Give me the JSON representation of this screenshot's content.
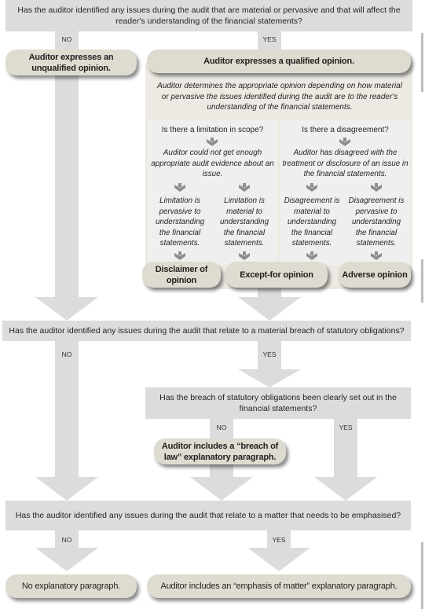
{
  "diagram": {
    "q1": {
      "text": "Has the auditor identified any issues during the audit that are material or pervasive and that will affect the reader's understanding of the financial statements?",
      "no_label": "NO",
      "yes_label": "YES"
    },
    "unqualified": "Auditor expresses an unqualified opinion.",
    "qualified": "Auditor expresses a qualified opinion.",
    "determines": "Auditor determines the appropriate opinion depending on how material or pervasive the issues identified during the audit are to the reader's understanding of the financial statements.",
    "scope": {
      "question": "Is there a limitation in scope?",
      "detail": "Auditor could not get enough appropriate audit evidence about an issue.",
      "pervasive": "Limitation is pervasive to understanding the financial statements.",
      "material": "Limitation is material to understanding the financial statements."
    },
    "disagreement": {
      "question": "Is there a disagreement?",
      "detail": "Auditor has disagreed with the treatment or disclosure of an issue in the financial statements.",
      "material": "Disagreement is material to understanding the financial statements.",
      "pervasive": "Disagreement is pervasive to understanding the financial statements."
    },
    "outcomes": {
      "disclaimer": "Disclaimer of opinion",
      "except_for": "Except-for opinion",
      "adverse": "Adverse opinion"
    },
    "q2": {
      "text": "Has the auditor identified any issues during the audit that relate to a material breach of statutory obligations?",
      "no_label": "NO",
      "yes_label": "YES"
    },
    "q2b": {
      "text": "Has the breach of statutory obligations been clearly set out in the financial statements?",
      "no_label": "NO",
      "yes_label": "YES"
    },
    "breach_of_law": "Auditor includes a “breach of law” explanatory paragraph.",
    "q3": {
      "text": "Has the auditor identified any issues during the audit that relate to a matter that needs to be emphasised?",
      "no_label": "NO",
      "yes_label": "YES"
    },
    "no_paragraph": "No explanatory paragraph.",
    "emphasis": "Auditor includes an “emphasis of matter” explanatory paragraph."
  }
}
